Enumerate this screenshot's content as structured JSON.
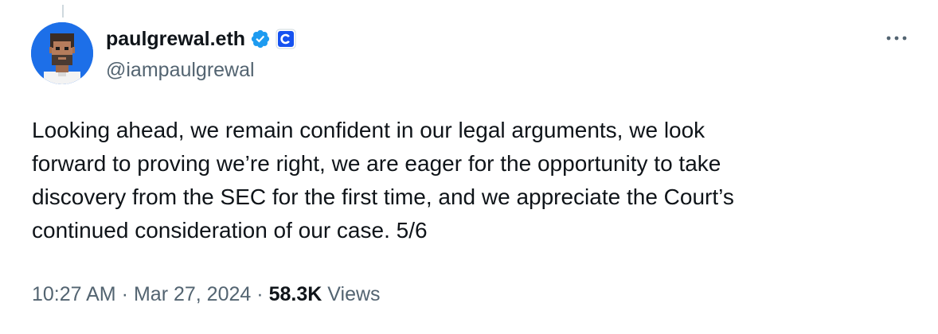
{
  "author": {
    "display_name": "paulgrewal.eth",
    "handle": "@iampaulgrewal",
    "verified_icon": "verified-badge-icon",
    "affiliation_icon": "coinbase-logo-icon",
    "avatar_icon": "pixel-art-avatar-icon"
  },
  "tweet": {
    "text": "Looking ahead, we remain confident in our legal arguments, we look\nforward to proving we’re right, we are eager for the opportunity to take\ndiscovery from the SEC for the first time, and we appreciate the Court’s\ncontinued consideration of our case. 5/6"
  },
  "meta": {
    "time": "10:27 AM",
    "separator": "·",
    "date": "Mar 27, 2024",
    "views_count": "58.3K",
    "views_label": "Views"
  },
  "actions": {
    "more_icon": "more-dots-icon"
  },
  "colors": {
    "verified": "#1d9bf0",
    "coinbase": "#1652f0",
    "secondary_text": "#536471",
    "primary_text": "#0f1419"
  }
}
